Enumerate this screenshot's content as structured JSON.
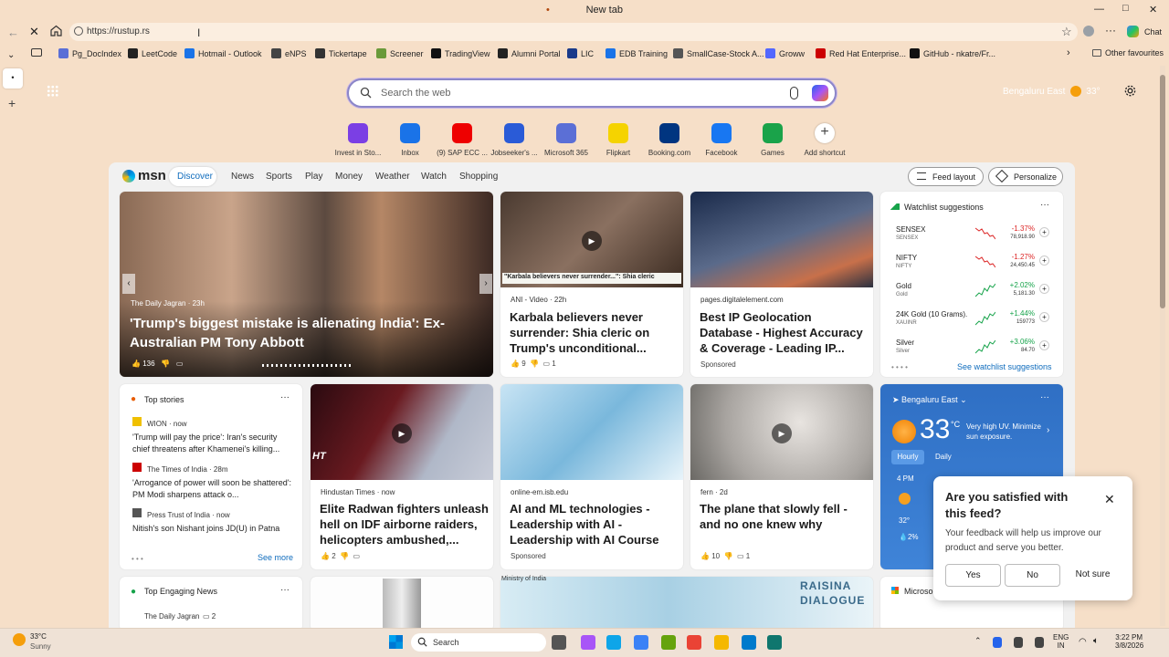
{
  "window": {
    "tab_title": "New tab",
    "minimize": "—",
    "maximize": "□",
    "close": "✕"
  },
  "address": {
    "url": "https://rustup.rs"
  },
  "browser": {
    "chat_label": "Chat",
    "more_label": "···"
  },
  "bookmarks": [
    {
      "label": "Pg_DocIndex",
      "color": "#5a6fd6"
    },
    {
      "label": "LeetCode",
      "color": "#222"
    },
    {
      "label": "Hotmail - Outlook",
      "color": "#1a73e8"
    },
    {
      "label": "eNPS",
      "color": "#444"
    },
    {
      "label": "Tickertape",
      "color": "#333"
    },
    {
      "label": "Screener",
      "color": "#6a9a3a"
    },
    {
      "label": "TradingView",
      "color": "#111"
    },
    {
      "label": "Alumni Portal",
      "color": "#222"
    },
    {
      "label": "LIC",
      "color": "#1a3a8a"
    },
    {
      "label": "EDB Training",
      "color": "#1a73e8"
    },
    {
      "label": "SmallCase-Stock A...",
      "color": "#555"
    },
    {
      "label": "Groww",
      "color": "#5367ff"
    },
    {
      "label": "Red Hat Enterprise...",
      "color": "#c00"
    },
    {
      "label": "GitHub - nkatre/Fr...",
      "color": "#111"
    }
  ],
  "other_favourites": "Other favourites",
  "weather_top": {
    "location": "Bengaluru East",
    "temp": "33°"
  },
  "search": {
    "placeholder": "Search the web"
  },
  "shortcuts": [
    {
      "label": "Invest in Sto...",
      "color": "#7b3fe4"
    },
    {
      "label": "Inbox",
      "color": "#1a73e8"
    },
    {
      "label": "(9) SAP ECC ...",
      "color": "#e00"
    },
    {
      "label": "Jobseeker's ...",
      "color": "#2a5bd7"
    },
    {
      "label": "Microsoft 365",
      "color": "#5b6fd6"
    },
    {
      "label": "Flipkart",
      "color": "#f5d300"
    },
    {
      "label": "Booking.com",
      "color": "#003580"
    },
    {
      "label": "Facebook",
      "color": "#1877f2"
    },
    {
      "label": "Games",
      "color": "#1aa34a"
    },
    {
      "label": "Add shortcut",
      "color": "#ffffff"
    }
  ],
  "msn": {
    "logo": "msn",
    "nav": [
      "Discover",
      "News",
      "Sports",
      "Play",
      "Money",
      "Weather",
      "Watch",
      "Shopping"
    ],
    "feed_layout": "Feed layout",
    "personalize": "Personalize"
  },
  "hero": {
    "source": "The Daily Jagran · 23h",
    "title": "'Trump's biggest mistake is alienating India': Ex-Australian PM Tony Abbott",
    "likes": "136"
  },
  "card2": {
    "overlay": "\"Karbala believers never surrender...\": Shia cleric",
    "source": "ANI - Video · 22h",
    "title": "Karbala believers never surrender: Shia cleric on Trump's unconditional...",
    "likes": "9",
    "comments": "1"
  },
  "card3": {
    "source": "pages.digitalelement.com",
    "title": "Best IP Geolocation Database - Highest Accuracy & Coverage - Leading IP...",
    "sponsored": "Sponsored"
  },
  "watchlist": {
    "title": "Watchlist suggestions",
    "rows": [
      {
        "name": "SENSEX",
        "sub": "SENSEX",
        "change": "-1.37%",
        "price": "78,918.90",
        "up": false
      },
      {
        "name": "NIFTY",
        "sub": "NIFTY",
        "change": "-1.27%",
        "price": "24,450.45",
        "up": false
      },
      {
        "name": "Gold",
        "sub": "Gold",
        "change": "+2.02%",
        "price": "5,181.30",
        "up": true
      },
      {
        "name": "24K Gold (10 Grams)...",
        "sub": "XAUINR",
        "change": "+1.44%",
        "price": "159773",
        "up": true
      },
      {
        "name": "Silver",
        "sub": "Silver",
        "change": "+3.06%",
        "price": "84.70",
        "up": true
      }
    ],
    "see_more": "See watchlist suggestions"
  },
  "top_stories": {
    "title": "Top stories",
    "items": [
      {
        "source": "WION · now",
        "title": "'Trump will pay the price': Iran's security chief threatens after Khamenei's killing..."
      },
      {
        "source": "The Times of India · 28m",
        "title": "'Arrogance of power will soon be shattered': PM Modi sharpens attack o..."
      },
      {
        "source": "Press Trust of India · now",
        "title": "Nitish's son Nishant joins JD(U) in Patna"
      }
    ],
    "see_more": "See more"
  },
  "card5": {
    "source": "Hindustan Times · now",
    "title": "Elite Radwan fighters unleash hell on IDF airborne raiders, helicopters ambushed,...",
    "likes": "2",
    "badge": "HT"
  },
  "card6": {
    "source": "online-em.isb.edu",
    "title": "AI and ML technologies - Leadership with AI - Leadership with AI Course",
    "sponsored": "Sponsored"
  },
  "card7": {
    "source": "fern · 2d",
    "title": "The plane that slowly fell - and no one knew why",
    "likes": "10",
    "comments": "1"
  },
  "weather_card": {
    "location": "Bengaluru East",
    "temp": "33",
    "unit": "°C",
    "uv": "Very high UV. Minimize sun exposure.",
    "tabs": [
      "Hourly",
      "Daily"
    ],
    "hour": "4 PM",
    "hour_temp": "32°",
    "hour_rain": "2%"
  },
  "top_engaging": {
    "title": "Top Engaging News",
    "source": "The Daily Jagran",
    "comments": "2"
  },
  "bottom_banner": {
    "text": "RAISINA DIALOGUE",
    "ministry": "Ministry of India"
  },
  "feedback": {
    "title": "Are you satisfied with this feed?",
    "body": "Your feedback will help us improve our product and serve you better.",
    "yes": "Yes",
    "no": "No",
    "not_sure": "Not sure"
  },
  "micro_label": "Microso",
  "taskbar": {
    "temp": "33°C",
    "cond": "Sunny",
    "search": "Search",
    "lang1": "ENG",
    "lang2": "IN",
    "time": "3:22 PM",
    "date": "3/8/2026"
  }
}
